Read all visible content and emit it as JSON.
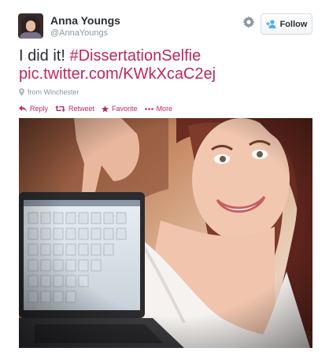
{
  "user": {
    "display_name": "Anna Youngs",
    "handle": "@AnnaYoungs"
  },
  "header": {
    "settings_icon": "gear-icon",
    "follow_label": "Follow",
    "follow_icon": "add-person-icon"
  },
  "tweet": {
    "text_plain": "I did it!",
    "hashtag": "#DissertationSelfie",
    "link": "pic.twitter.com/KWkXcaC2ej",
    "location": "from Winchester"
  },
  "actions": [
    {
      "label": "Reply",
      "icon": "reply-icon"
    },
    {
      "label": "Retweet",
      "icon": "retweet-icon"
    },
    {
      "label": "Favorite",
      "icon": "star-icon"
    },
    {
      "label": "More",
      "icon": "more-dots-icon"
    }
  ],
  "colors": {
    "accent": "#c0275a",
    "muted": "#8899a6",
    "text": "#292f33"
  }
}
